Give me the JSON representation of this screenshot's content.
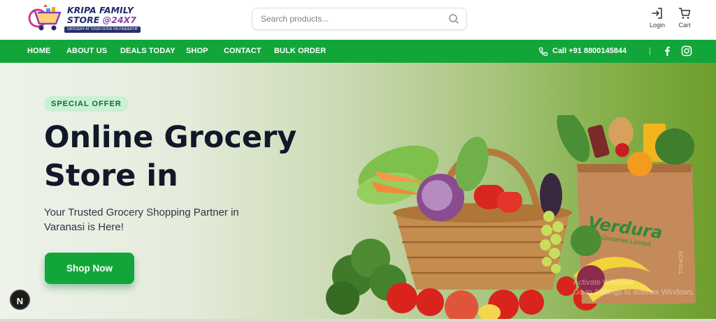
{
  "brand": {
    "name_line1": "KRIPA FAMILY",
    "name_line2_a": "STORE ",
    "name_line2_b": "@24X7",
    "tagline": "GROCERY AT YOUR DOOR ON FINGERTIP"
  },
  "search": {
    "placeholder": "Search products..."
  },
  "actions": {
    "login": "Login",
    "cart": "Cart"
  },
  "nav": {
    "items": [
      "HOME",
      "ABOUT US",
      "DEALS TODAY",
      "SHOP",
      "CONTACT",
      "BULK ORDER"
    ],
    "phone": "Call +91 8800145844",
    "social": [
      "facebook-icon",
      "instagram-icon"
    ]
  },
  "hero": {
    "badge": "SPECIAL OFFER",
    "title_line1": "Online Grocery",
    "title_line2": "Store in",
    "subtitle": "Your Trusted Grocery Shopping Partner in Varanasi is Here!",
    "cta": "Shop Now",
    "bag_brand": "Verdura",
    "bag_sub": "Groceries Limited",
    "scroll_label": "SCROLL"
  },
  "overlay": {
    "watermark_line1": "Activate Windows",
    "watermark_line2": "Go to Settings to activate Windows.",
    "dev_badge": "N"
  },
  "colors": {
    "brand_green": "#12a63a",
    "badge_bg": "#c9f1d4",
    "text_dark": "#111827"
  }
}
